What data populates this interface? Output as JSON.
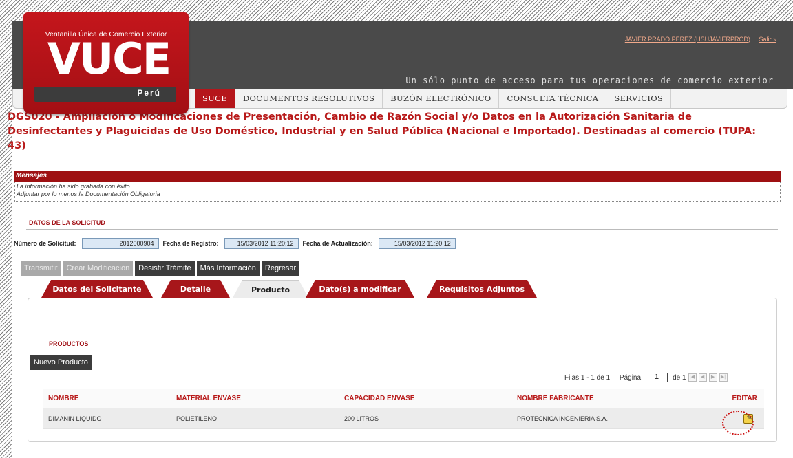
{
  "header": {
    "logo_top": "Ventanilla Única de Comercio Exterior",
    "logo_word": "VUCE",
    "logo_country": "Perú",
    "user_link": "JAVIER PRADO PEREZ (USUJAVIERPROD)",
    "logout_link": "Salir »",
    "tagline": "Un sólo punto de acceso para tus operaciones de comercio exterior"
  },
  "nav": {
    "items": [
      {
        "label": "SUCE"
      },
      {
        "label": "DOCUMENTOS RESOLUTIVOS"
      },
      {
        "label": "BUZÓN ELECTRÓNICO"
      },
      {
        "label": "CONSULTA TÉCNICA"
      },
      {
        "label": "SERVICIOS"
      }
    ]
  },
  "title": "DGS020 - Ampliación o Modificaciones de Presentación, Cambio de Razón Social y/o Datos en la Autorización Sanitaria de Desinfectantes y Plaguicidas de Uso Doméstico, Industrial y en Salud Pública (Nacional e Importado). Destinadas al comercio (TUPA: 43)",
  "messages": {
    "header": "Mensajes",
    "line1": "La información ha sido grabada con éxito.",
    "line2": "Adjuntar por lo menos la Documentación Obligatoria"
  },
  "solicitud": {
    "section": "DATOS DE LA SOLICITUD",
    "numero_label": "Número de Solicitud:",
    "numero_value": "2012000904",
    "registro_label": "Fecha de Registro:",
    "registro_value": "15/03/2012 11:20:12",
    "actualizacion_label": "Fecha de Actualización:",
    "actualizacion_value": "15/03/2012 11:20:12"
  },
  "actions": {
    "transmitir": "Transmitir",
    "crear": "Crear Modificación",
    "desistir": "Desistir Trámite",
    "mas_info": "Más Información",
    "regresar": "Regresar"
  },
  "tabs": [
    {
      "label": "Datos del Solicitante"
    },
    {
      "label": "Detalle"
    },
    {
      "label": "Producto"
    },
    {
      "label": "Dato(s) a modificar"
    },
    {
      "label": "Requisitos Adjuntos"
    }
  ],
  "productos": {
    "section": "PRODUCTOS",
    "new_button": "Nuevo Producto",
    "rows_info": "Filas 1 - 1 de 1.",
    "page_label": "Página",
    "page_value": "1",
    "page_of": "de 1",
    "columns": [
      "NOMBRE",
      "MATERIAL ENVASE",
      "CAPACIDAD ENVASE",
      "NOMBRE FABRICANTE",
      "EDITAR"
    ],
    "rows": [
      {
        "nombre": "DIMANIN LIQUIDO",
        "material": "POLIETILENO",
        "capacidad": "200 LITROS",
        "fabricante": "PROTECNICA INGENIERIA S.A."
      }
    ]
  }
}
